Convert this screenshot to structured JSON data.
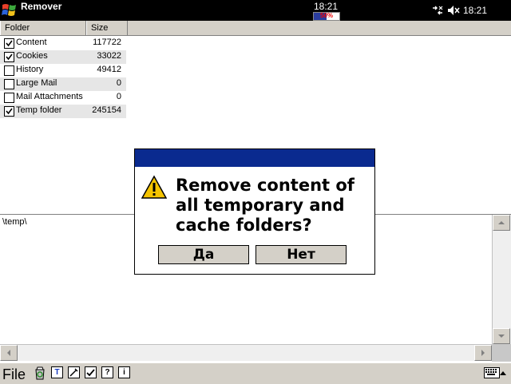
{
  "titlebar": {
    "app_title": "Remover",
    "center_time": "18:21",
    "battery_percent": 50,
    "battery_label": "50%",
    "tray_time": "18:21"
  },
  "table": {
    "headers": {
      "folder": "Folder",
      "size": "Size"
    },
    "rows": [
      {
        "name": "Content",
        "size": "117722",
        "checked": true
      },
      {
        "name": "Cookies",
        "size": "33022",
        "checked": true
      },
      {
        "name": "History",
        "size": "49412",
        "checked": false
      },
      {
        "name": "Large Mail",
        "size": "0",
        "checked": false
      },
      {
        "name": "Mail Attachments",
        "size": "0",
        "checked": false
      },
      {
        "name": "Temp folder",
        "size": "245154",
        "checked": true
      }
    ]
  },
  "path": {
    "text": "\\temp\\"
  },
  "dialog": {
    "message": "Remove content of  all temporary and cache folders?",
    "yes_label": "Да",
    "no_label": "Нет"
  },
  "menubar": {
    "file_label": "File"
  },
  "colors": {
    "title_bg": "#000000",
    "dialog_title": "#0a2a8f",
    "row_alt": "#e6e6e6",
    "chrome": "#d4d0c8"
  }
}
